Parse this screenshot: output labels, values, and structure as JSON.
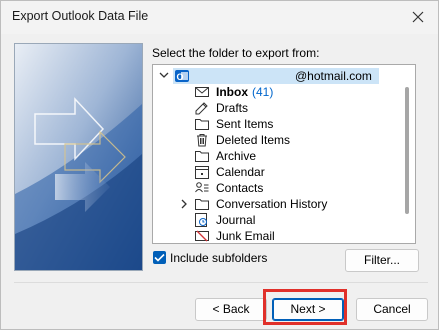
{
  "window": {
    "title": "Export Outlook Data File"
  },
  "prompt": "Select the folder to export from:",
  "tree": {
    "account": {
      "email": "@hotmail.com",
      "expanded": true,
      "icon": "outlook-icon"
    },
    "folders": [
      {
        "name": "Inbox",
        "count": "(41)",
        "icon": "mail-icon",
        "bold": true
      },
      {
        "name": "Drafts",
        "icon": "draft-icon"
      },
      {
        "name": "Sent Items",
        "icon": "folder-icon"
      },
      {
        "name": "Deleted Items",
        "icon": "trash-icon"
      },
      {
        "name": "Archive",
        "icon": "folder-icon"
      },
      {
        "name": "Calendar",
        "icon": "calendar-icon"
      },
      {
        "name": "Contacts",
        "icon": "contacts-icon"
      },
      {
        "name": "Conversation History",
        "icon": "folder-icon",
        "collapsed": true
      },
      {
        "name": "Journal",
        "icon": "journal-icon"
      },
      {
        "name": "Junk Email",
        "icon": "junk-icon"
      }
    ]
  },
  "include_subfolders": {
    "label": "Include subfolders",
    "checked": true
  },
  "buttons": {
    "filter": "Filter...",
    "back": "< Back",
    "next": "Next >",
    "cancel": "Cancel"
  },
  "colors": {
    "accent": "#005fb8",
    "highlight": "#e0302a",
    "selection": "#cce4f7"
  }
}
